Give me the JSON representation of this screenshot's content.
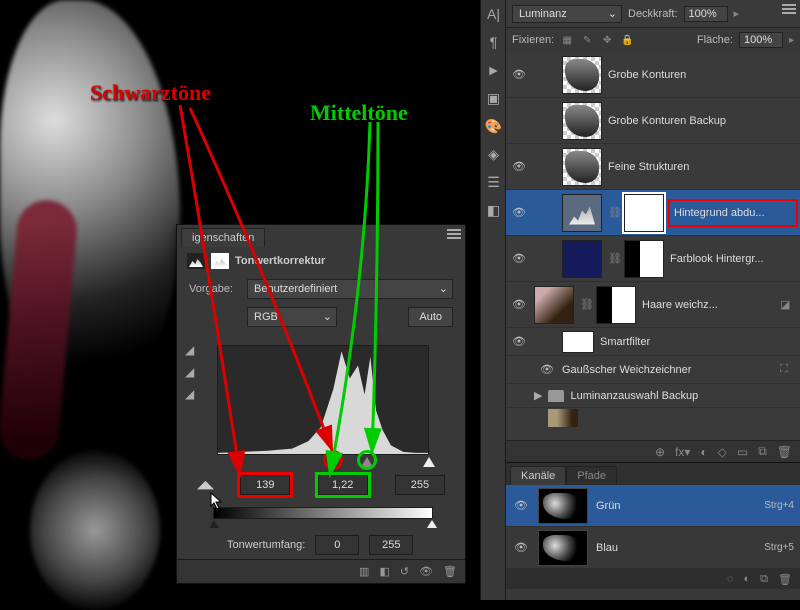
{
  "annotations": {
    "schwarz": "Schwarztöne",
    "mittel": "Mitteltöne"
  },
  "tool_icons": [
    "A|",
    "¶",
    "►",
    "▣",
    "🎨",
    "◈",
    "☰",
    "◧"
  ],
  "layers_panel": {
    "blend_mode": "Luminanz",
    "opacity_label": "Deckkraft:",
    "opacity_value": "100%",
    "lock_label": "Fixieren:",
    "fill_label": "Fläche:",
    "fill_value": "100%",
    "layers": [
      {
        "name": "Grobe Konturen"
      },
      {
        "name": "Grobe Konturen Backup"
      },
      {
        "name": "Feine Strukturen"
      },
      {
        "name": "Hintegrund abdu..."
      },
      {
        "name": "Farblook Hintergr..."
      },
      {
        "name": "Haare weichz..."
      },
      {
        "name": "Smartfilter"
      },
      {
        "name": "Gaußscher Weichzeichner"
      },
      {
        "name": "Luminanzauswahl Backup"
      }
    ],
    "footer_icons": [
      "⊕",
      "fx▾",
      "◐",
      "◇",
      "▭",
      "⧉",
      "🗑"
    ]
  },
  "channels_panel": {
    "tabs": {
      "active": "Kanäle",
      "inactive": "Pfade"
    },
    "channels": [
      {
        "name": "Grün",
        "shortcut": "Strg+4"
      },
      {
        "name": "Blau",
        "shortcut": "Strg+5"
      }
    ],
    "footer_icons": [
      "◌",
      "◐",
      "⧉",
      "🗑"
    ]
  },
  "properties_panel": {
    "tab": "igenschaften",
    "title": "Tonwertkorrektur",
    "preset_label": "Vorgabe:",
    "preset_value": "Benutzerdefiniert",
    "channel_value": "RGB",
    "auto_label": "Auto",
    "input_black": "139",
    "input_gamma": "1,22",
    "input_white": "255",
    "output_label": "Tonwertumfang:",
    "output_black": "0",
    "output_white": "255",
    "footer_icons": [
      "▥",
      "◧",
      "↺",
      "👁",
      "🗑"
    ]
  },
  "chart_data": {
    "type": "area",
    "title": "Histogramm (Tonwertkorrektur)",
    "xlabel": "",
    "ylabel": "",
    "xlim": [
      0,
      255
    ],
    "x": [
      0,
      30,
      60,
      90,
      110,
      125,
      140,
      150,
      160,
      170,
      178,
      185,
      192,
      200,
      210,
      225,
      240,
      255
    ],
    "values": [
      1,
      2,
      3,
      5,
      12,
      25,
      60,
      95,
      70,
      82,
      55,
      90,
      40,
      22,
      8,
      2,
      1,
      1
    ],
    "ylim": [
      0,
      100
    ],
    "input_sliders": {
      "black": 139,
      "gamma": 1.22,
      "white": 255
    },
    "output_sliders": {
      "black": 0,
      "white": 255
    }
  }
}
